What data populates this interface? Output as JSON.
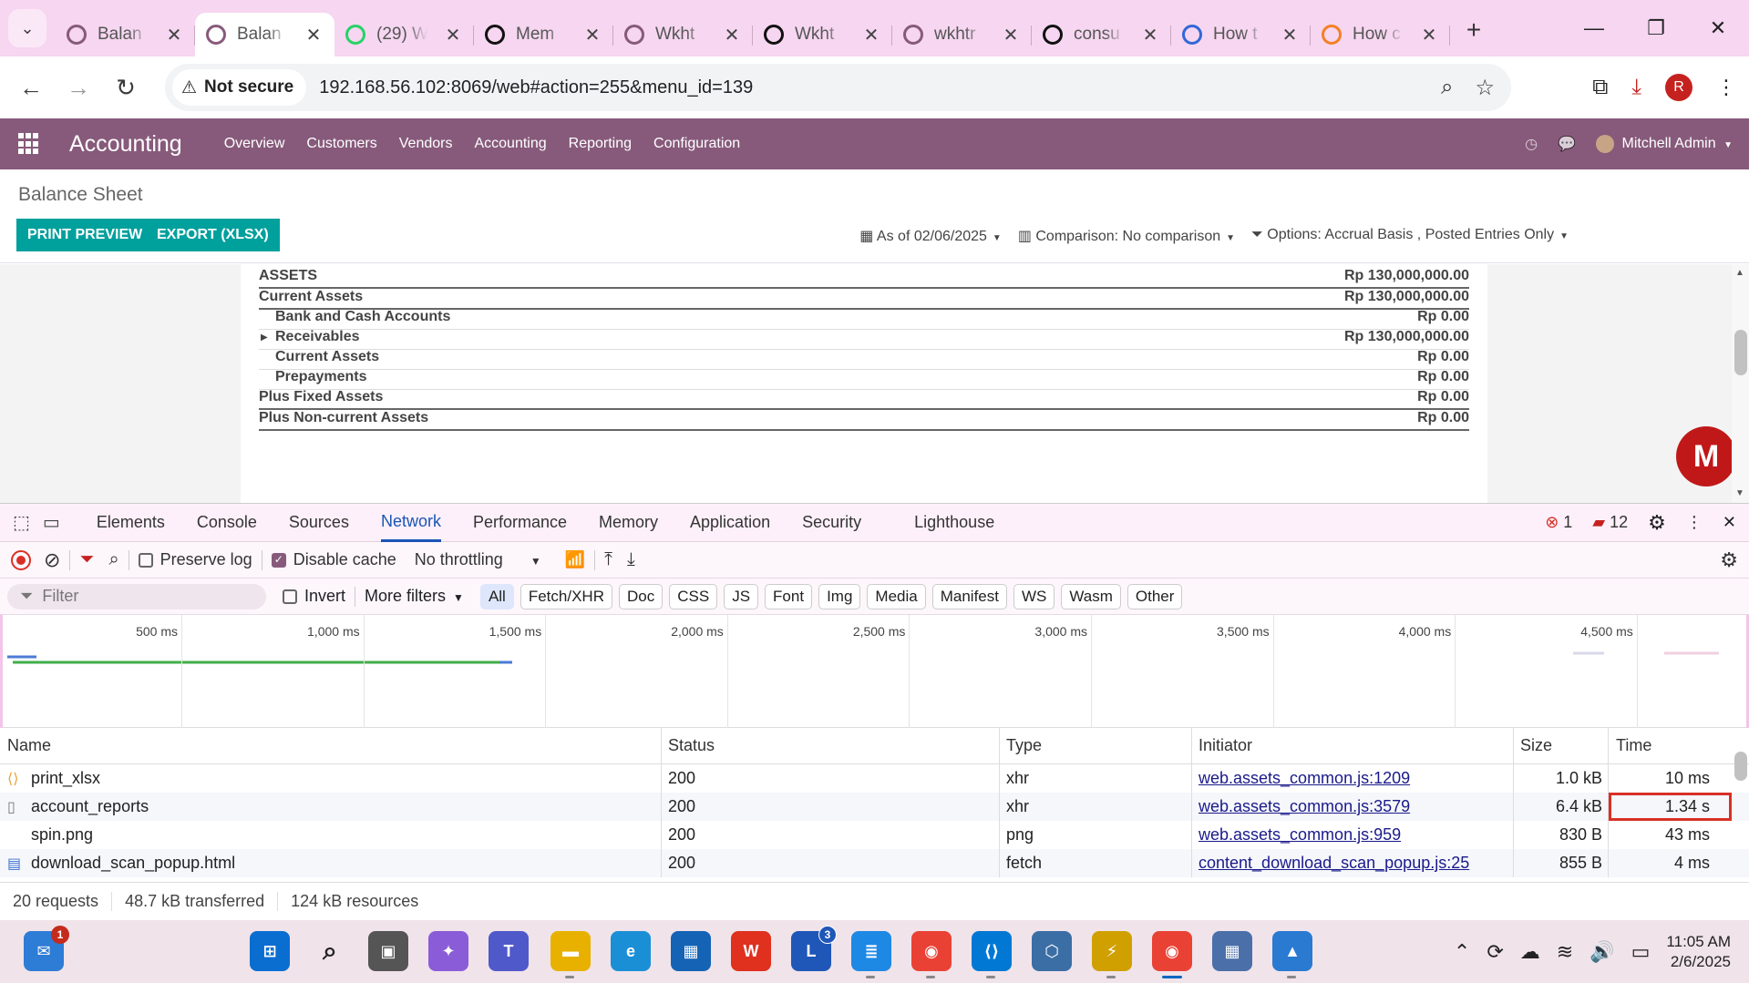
{
  "browser": {
    "tabs": [
      {
        "label": "Balan",
        "favicon": "odoo-icon",
        "color": "#875a7b",
        "active": false
      },
      {
        "label": "Balan",
        "favicon": "odoo-icon",
        "color": "#875a7b",
        "active": true
      },
      {
        "label": "(29) W",
        "favicon": "whatsapp-icon",
        "color": "#25d366",
        "active": false
      },
      {
        "label": "Mem",
        "favicon": "openai-icon",
        "color": "#111111",
        "active": false
      },
      {
        "label": "Wkht",
        "favicon": "odoo-icon",
        "color": "#875a7b",
        "active": false
      },
      {
        "label": "Wkht",
        "favicon": "github-icon",
        "color": "#111111",
        "active": false
      },
      {
        "label": "wkhtr",
        "favicon": "odoo-icon",
        "color": "#875a7b",
        "active": false
      },
      {
        "label": "consu",
        "favicon": "github-icon",
        "color": "#111111",
        "active": false
      },
      {
        "label": "How t",
        "favicon": "globe-icon",
        "color": "#3367d6",
        "active": false
      },
      {
        "label": "How c",
        "favicon": "stackoverflow-icon",
        "color": "#f48024",
        "active": false
      }
    ],
    "security_label": "Not secure",
    "url": "192.168.56.102:8069/web#action=255&menu_id=139",
    "profile_initial": "R"
  },
  "odoo": {
    "app_name": "Accounting",
    "menu": [
      "Overview",
      "Customers",
      "Vendors",
      "Accounting",
      "Reporting",
      "Configuration"
    ],
    "user": "Mitchell Admin",
    "breadcrumb": "Balance Sheet",
    "buttons": {
      "print": "PRINT PREVIEW",
      "export": "EXPORT (XLSX)"
    },
    "filters": {
      "date": "As of 02/06/2025",
      "comparison": "Comparison: No comparison",
      "options": "Options: Accrual Basis , Posted Entries Only"
    }
  },
  "report": {
    "rows": [
      {
        "name": "ASSETS",
        "value": "Rp 130,000,000.00",
        "level": 0
      },
      {
        "name": "Current Assets",
        "value": "Rp 130,000,000.00",
        "level": 0
      },
      {
        "name": "Bank and Cash Accounts",
        "value": "Rp 0.00",
        "level": 1
      },
      {
        "name": "Receivables",
        "value": "Rp 130,000,000.00",
        "level": 1
      },
      {
        "name": "Current Assets",
        "value": "Rp 0.00",
        "level": 1
      },
      {
        "name": "Prepayments",
        "value": "Rp 0.00",
        "level": 1
      },
      {
        "name": "Plus Fixed Assets",
        "value": "Rp 0.00",
        "level": 0
      },
      {
        "name": "Plus Non-current Assets",
        "value": "Rp 0.00",
        "level": 0
      }
    ]
  },
  "devtools": {
    "tabs": [
      "Elements",
      "Console",
      "Sources",
      "Network",
      "Performance",
      "Memory",
      "Application",
      "Security",
      "Lighthouse"
    ],
    "active_tab": "Network",
    "error_count": "1",
    "warning_count": "12",
    "preserve_log": "Preserve log",
    "disable_cache": "Disable cache",
    "throttling": "No throttling",
    "filter_placeholder": "Filter",
    "invert": "Invert",
    "more_filters": "More filters",
    "type_filters": [
      "All",
      "Fetch/XHR",
      "Doc",
      "CSS",
      "JS",
      "Font",
      "Img",
      "Media",
      "Manifest",
      "WS",
      "Wasm",
      "Other"
    ],
    "timeline_ticks": [
      "500 ms",
      "1,000 ms",
      "1,500 ms",
      "2,000 ms",
      "2,500 ms",
      "3,000 ms",
      "3,500 ms",
      "4,000 ms",
      "4,500 ms"
    ],
    "columns": [
      "Name",
      "Status",
      "Type",
      "Initiator",
      "Size",
      "Time"
    ],
    "requests": [
      {
        "name": "print_xlsx",
        "icon": "xhr-icon",
        "status": "200",
        "type": "xhr",
        "initiator": "web.assets_common.js:1209",
        "size": "1.0 kB",
        "time": "10 ms"
      },
      {
        "name": "account_reports",
        "icon": "document-icon",
        "status": "200",
        "type": "xhr",
        "initiator": "web.assets_common.js:3579",
        "size": "6.4 kB",
        "time": "1.34 s"
      },
      {
        "name": "spin.png",
        "icon": "image-icon",
        "status": "200",
        "type": "png",
        "initiator": "web.assets_common.js:959",
        "size": "830 B",
        "time": "43 ms"
      },
      {
        "name": "download_scan_popup.html",
        "icon": "html-icon",
        "status": "200",
        "type": "fetch",
        "initiator": "content_download_scan_popup.js:25",
        "size": "855 B",
        "time": "4 ms"
      }
    ],
    "summary": {
      "requests": "20 requests",
      "transferred": "48.7 kB transferred",
      "resources": "124 kB resources"
    }
  },
  "taskbar": {
    "mail_badge": "1",
    "l_badge": "3",
    "clock_time": "11:05 AM",
    "clock_date": "2/6/2025"
  }
}
